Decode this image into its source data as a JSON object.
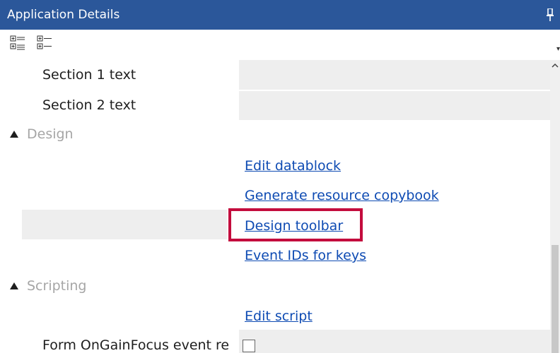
{
  "panel": {
    "title": "Application Details",
    "pin_glyph": "📌"
  },
  "toolbar": {
    "icons": [
      "categorized-view-icon",
      "alphabetical-view-icon"
    ],
    "dropdown_glyph": "▾"
  },
  "properties": {
    "section1_label": "Section 1 text",
    "section2_label": "Section 2 text",
    "design_category": "Design",
    "edit_datablock": "Edit datablock",
    "generate_resource_copybook": "Generate resource copybook",
    "design_toolbar": "Design toolbar",
    "event_ids_for_keys": "Event IDs for keys",
    "scripting_category": "Scripting",
    "edit_script": "Edit script",
    "form_ongainfocus_label": "Form OnGainFocus event re"
  },
  "colors": {
    "title_bar": "#2b579a",
    "link": "#0e4bb3",
    "highlight": "#c30c3d",
    "value_cell": "#eeeeee"
  }
}
